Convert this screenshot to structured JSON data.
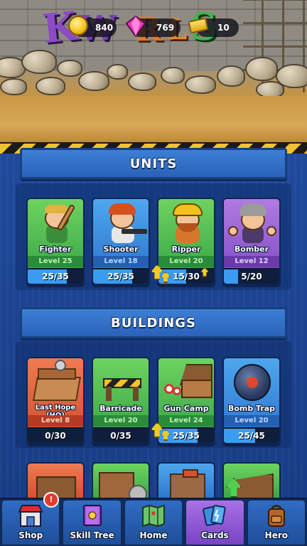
{
  "resources": {
    "coins": "840",
    "gems": "769",
    "cash": "10"
  },
  "units": {
    "header": "UNITS",
    "cards": [
      {
        "name": "Fighter",
        "level": "Level 25",
        "progress_text": "25/35",
        "progress": 0.71,
        "color": "green"
      },
      {
        "name": "Shooter",
        "level": "Level 18",
        "progress_text": "25/35",
        "progress": 0.71,
        "color": "blue"
      },
      {
        "name": "Ripper",
        "level": "Level 20",
        "progress_text": "15/30",
        "progress": 0.5,
        "color": "green"
      },
      {
        "name": "Bomber",
        "level": "Level 12",
        "progress_text": "5/20",
        "progress": 0.25,
        "color": "purple"
      }
    ]
  },
  "buildings": {
    "header": "BUILDINGS",
    "cards": [
      {
        "name": "Last Hope (HQ)",
        "level": "Level 8",
        "progress_text": "0/30",
        "progress": 0.0,
        "color": "red"
      },
      {
        "name": "Barricade",
        "level": "Level 20",
        "progress_text": "0/35",
        "progress": 0.0,
        "color": "green"
      },
      {
        "name": "Gun Camp",
        "level": "Level 24",
        "progress_text": "25/35",
        "progress": 0.71,
        "color": "green"
      },
      {
        "name": "Bomb Trap",
        "level": "Level 20",
        "progress_text": "25/45",
        "progress": 0.56,
        "color": "blue"
      }
    ]
  },
  "nav": {
    "shop": "Shop",
    "skill_tree": "Skill Tree",
    "home": "Home",
    "cards": "Cards",
    "hero": "Hero"
  }
}
